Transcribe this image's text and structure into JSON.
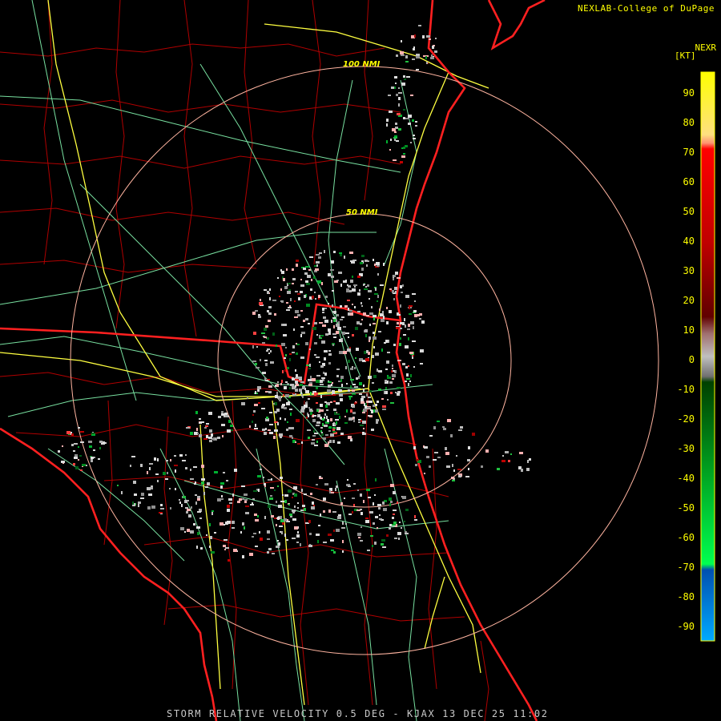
{
  "credit": "NEXLAB-College of DuPage",
  "product": "NEXR",
  "units": "[KT]",
  "footer": "STORM RELATIVE VELOCITY 0.5 DEG - KJAX 13 DEC 25 11:02",
  "range_rings": [
    {
      "label": "100 NMI"
    },
    {
      "label": "50 NMI"
    }
  ],
  "legend": {
    "ticks": [
      90,
      80,
      70,
      60,
      50,
      40,
      30,
      20,
      10,
      0,
      -10,
      -20,
      -30,
      -40,
      -50,
      -60,
      -70,
      -80,
      -90
    ],
    "colors": {
      "yellow": "#ffff00",
      "orange": "#ffb070",
      "red": "#ff0000",
      "dark_red": "#700000",
      "gray": "#a0a0a0",
      "dark_green": "#005a00",
      "green": "#00e640",
      "blue": "#0060d0",
      "light_blue": "#00a8ff"
    }
  },
  "colors": {
    "coast": "#ff2020",
    "county": "#c00000",
    "highway": "#ffff40",
    "road": "#78e0a0",
    "ring": "#ffb4a0",
    "label": "#ffff00"
  }
}
